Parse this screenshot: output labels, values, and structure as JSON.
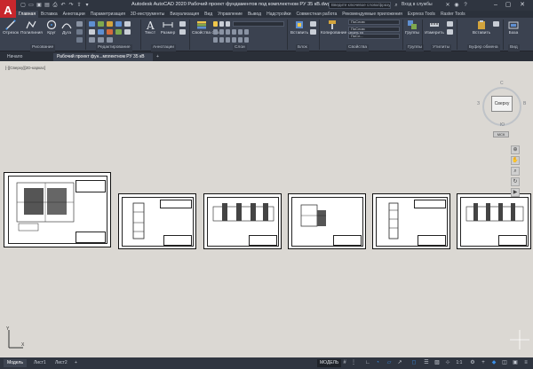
{
  "app": {
    "title": "Autodesk AutoCAD 2020  Рабочий проект фундаментов под комплектном РУ 35 кВ.dwg",
    "logo_letter": "A",
    "search_placeholder": "Введите ключевое слово/фразу",
    "sign_in": "Вход в службы"
  },
  "ribbon_tabs": [
    "Главная",
    "Вставка",
    "Аннотации",
    "Параметризация",
    "3D-инструменты",
    "Визуализация",
    "Вид",
    "Управление",
    "Вывод",
    "Надстройки",
    "Совместная работа",
    "Рекомендуемые приложения",
    "Express Tools",
    "Raster Tools"
  ],
  "ribbon": {
    "tools": {
      "otrezok": "Отрезок",
      "polyline": "Полилиния",
      "krug": "Круг",
      "duga": "Дуга",
      "text": "Текст",
      "razmer": "Размер",
      "layer_props": "Свойства слоя",
      "copy_props": "Копирование свойств",
      "groups": "Группы",
      "measure": "Измерить",
      "insert": "Вставить",
      "clipboard": "Буфер обмена",
      "base": "База"
    },
    "panels": {
      "draw": "Рисование",
      "modify": "Редактирование",
      "annotate": "Аннотации",
      "layers": "Слои",
      "block": "Блок",
      "properties": "Свойства",
      "groups": "Группы",
      "utilities": "Утилиты",
      "clipboard": "Буфер обмена",
      "view": "Вид"
    },
    "bylayer_values": [
      "ПоСлою",
      "ПоСлою",
      "ПоСл..."
    ]
  },
  "file_tabs": [
    "Начало",
    "Рабочий проект фун...мплектном РУ 35 кВ"
  ],
  "viewport_label": "[-][Сверху][2D-каркас]",
  "viewcube": {
    "face": "Сверху",
    "north": "С",
    "south": "Ю",
    "east": "В",
    "west": "З",
    "wcs": "МСК"
  },
  "status_tabs": [
    "Модель",
    "Лист1",
    "Лист2"
  ],
  "status": {
    "model_label": "МОДЕЛЬ",
    "scale": "1:1"
  },
  "colors": {
    "title_bg": "#2f3540",
    "ribbon_bg": "#3b4250",
    "canvas_bg": "#dbd8d3",
    "logo": "#c8272d",
    "accent_blue": "#3a8ee6"
  }
}
